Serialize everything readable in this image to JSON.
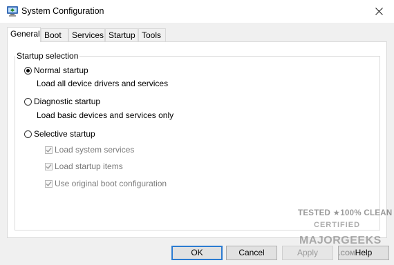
{
  "window": {
    "title": "System Configuration",
    "app_icon": "system-config-icon",
    "close_icon": "close-icon"
  },
  "tabs": [
    {
      "label": "General",
      "selected": true
    },
    {
      "label": "Boot"
    },
    {
      "label": "Services"
    },
    {
      "label": "Startup"
    },
    {
      "label": "Tools"
    }
  ],
  "startup_selection": {
    "legend": "Startup selection",
    "options": [
      {
        "label": "Normal startup",
        "selected": true,
        "description": "Load all device drivers and services"
      },
      {
        "label": "Diagnostic startup",
        "selected": false,
        "description": "Load basic devices and services only"
      },
      {
        "label": "Selective startup",
        "selected": false
      }
    ],
    "selective_items": [
      {
        "label": "Load system services",
        "checked": true,
        "enabled": false
      },
      {
        "label": "Load startup items",
        "checked": true,
        "enabled": false
      },
      {
        "label": "Use original boot configuration",
        "checked": true,
        "enabled": false
      }
    ]
  },
  "buttons": {
    "ok": "OK",
    "cancel": "Cancel",
    "apply": "Apply",
    "help": "Help"
  },
  "watermark": {
    "line1": "TESTED ★100% CLEAN",
    "line2": "CERTIFIED",
    "line3": "MAJORGEEKS",
    "line4": ".COM"
  },
  "colors": {
    "default_button_border": "#2b7bd1",
    "disabled_text": "#9b9b9b"
  }
}
